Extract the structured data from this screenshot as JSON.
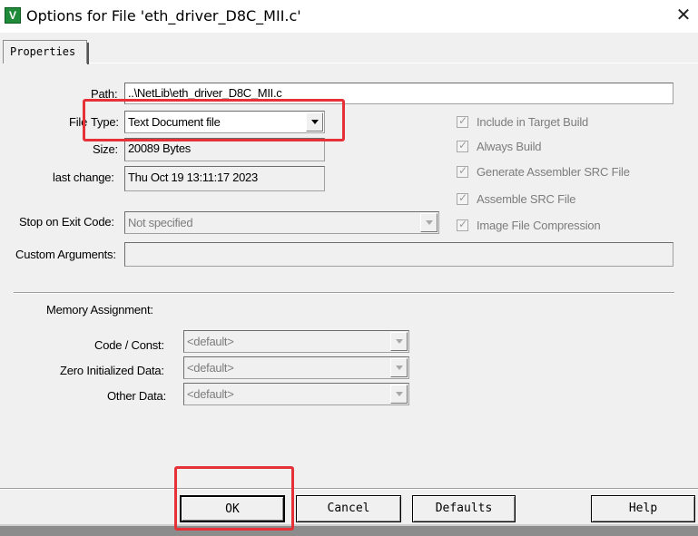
{
  "window": {
    "title": "Options for File 'eth_driver_D8C_MII.c'",
    "app_icon_glyph": "V",
    "close_glyph": "✕"
  },
  "tabs": [
    {
      "label": "Properties"
    }
  ],
  "properties": {
    "path_label": "Path:",
    "path_value": "..\\NetLib\\eth_driver_D8C_MII.c",
    "file_type_label_1": "File",
    "file_type_label_2": "Type:",
    "file_type_value": "Text Document file",
    "size_label": "Size:",
    "size_value": "20089 Bytes",
    "last_change_label": "last change:",
    "last_change_value": "Thu Oct 19 13:11:17 2023",
    "stop_label": "Stop on Exit Code:",
    "stop_value": "Not specified",
    "custom_args_label": "Custom Arguments:",
    "custom_args_value": ""
  },
  "options": [
    {
      "label": "Include in Target Build",
      "checked": true
    },
    {
      "label": "Always Build",
      "checked": true
    },
    {
      "label": "Generate Assembler SRC File",
      "checked": true
    },
    {
      "label": "Assemble SRC File",
      "checked": true
    },
    {
      "label": "Image File Compression",
      "checked": true
    }
  ],
  "memory": {
    "heading": "Memory Assignment:",
    "code_const_label": "Code / Const:",
    "code_const_value": "<default>",
    "zero_init_label": "Zero Initialized Data:",
    "zero_init_value": "<default>",
    "other_label": "Other Data:",
    "other_value": "<default>"
  },
  "buttons": {
    "ok": "OK",
    "cancel": "Cancel",
    "defaults": "Defaults",
    "help": "Help"
  },
  "colors": {
    "highlight_box": "#e53238",
    "app_icon": "#1f8a3a"
  }
}
